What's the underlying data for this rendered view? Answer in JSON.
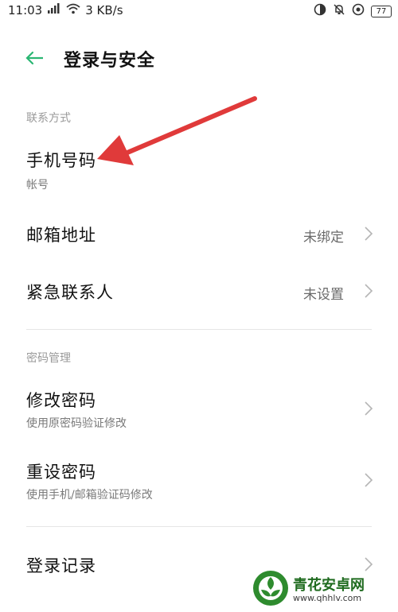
{
  "status_bar": {
    "time": "11:03",
    "network_speed": "3 KB/s",
    "battery": "77",
    "icons": [
      "signal-icon",
      "wifi-icon",
      "data-saver-icon",
      "bell-off-icon",
      "at-icon",
      "battery-icon"
    ]
  },
  "header": {
    "back_icon": "arrow-left-icon",
    "title": "登录与安全"
  },
  "sections": {
    "contact": {
      "title": "联系方式",
      "phone": {
        "label": "手机号码",
        "sub": "帐号"
      },
      "email": {
        "label": "邮箱地址",
        "value": "未绑定"
      },
      "emergency": {
        "label": "紧急联系人",
        "value": "未设置"
      }
    },
    "password": {
      "title": "密码管理",
      "change": {
        "label": "修改密码",
        "sub": "使用原密码验证修改"
      },
      "reset": {
        "label": "重设密码",
        "sub": "使用手机/邮箱验证码修改"
      }
    },
    "login": {
      "history": {
        "label": "登录记录"
      }
    }
  },
  "annotation": {
    "color": "#e03a3a",
    "icon": "red-arrow-annotation"
  },
  "watermark": {
    "text": "青花安卓网",
    "url": "www.qhhlv.com"
  },
  "colors": {
    "accent": "#2bb673",
    "chevron": "#b5b5b5"
  }
}
